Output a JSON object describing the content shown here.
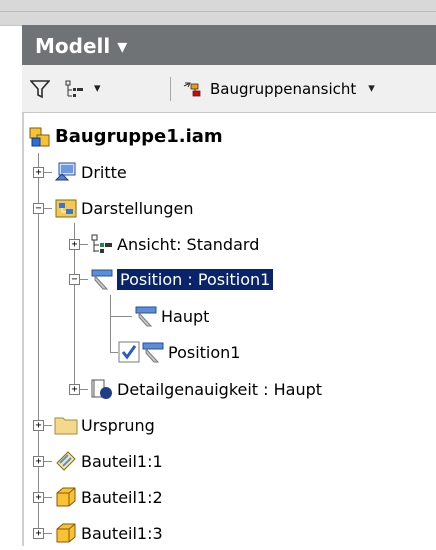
{
  "panel": {
    "title": "Modell ▾"
  },
  "toolbar": {
    "filter_caret": "▾",
    "view_label": "Baugruppenansicht",
    "view_caret": "▾"
  },
  "tree": {
    "root": "Baugruppe1.iam",
    "dritte": "Dritte",
    "darstellungen": "Darstellungen",
    "ansicht": "Ansicht: Standard",
    "position": "Position : Position1",
    "haupt": "Haupt",
    "position1": "Position1",
    "detail": "Detailgenauigkeit : Haupt",
    "ursprung": "Ursprung",
    "bauteil1": "Bauteil1:1",
    "bauteil2": "Bauteil1:2",
    "bauteil3": "Bauteil1:3"
  },
  "expanders": {
    "plus": "+",
    "minus": "−"
  },
  "colors": {
    "header_bg": "#6f7376",
    "selection": "#0a246a",
    "folder": "#f2d98c",
    "part": "#f7c236"
  }
}
